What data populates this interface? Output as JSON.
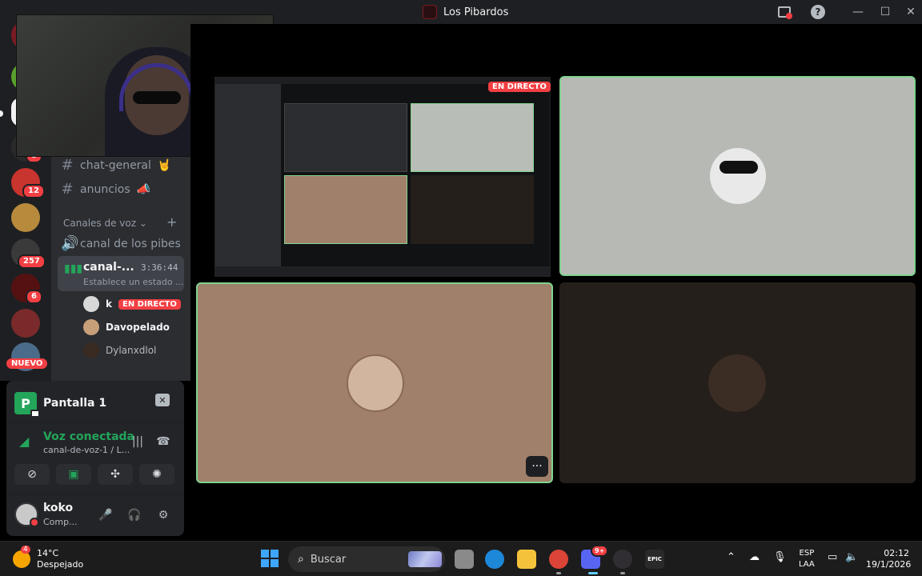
{
  "window": {
    "title": "Los Pibardos"
  },
  "servers": {
    "badges": [
      "8",
      "12",
      "257",
      "6"
    ],
    "new_label": "NUEVO"
  },
  "channels": {
    "text": [
      {
        "name": "chat-general",
        "emoji": "🤘"
      },
      {
        "name": "anuncios",
        "emoji": "📣"
      }
    ],
    "voice_category": "Canales de voz",
    "voice_channels": [
      {
        "name": "canal de los pibes"
      }
    ],
    "active_voice": {
      "name": "canal-...",
      "time": "3:36:44",
      "status": "Establece un estado ..."
    },
    "members": [
      {
        "name": "k",
        "badge": "EN DIRECTO"
      },
      {
        "name": "Davopelado"
      },
      {
        "name": "Dylanxdlol"
      }
    ]
  },
  "user_panel": {
    "screen_label": "Pantalla 1",
    "voice_title": "Voz conectada",
    "voice_sub": "canal-de-voz-1 / L...",
    "username": "koko",
    "user_status": "Comp..."
  },
  "stage": {
    "live_label": "EN DIRECTO",
    "nested_title": "Los Pibardos",
    "more": "···"
  },
  "taskbar": {
    "temp": "14°C",
    "weather": "Despejado",
    "weather_badge": "4",
    "search_placeholder": "Buscar",
    "discord_badge": "9+",
    "lang_top": "ESP",
    "lang_bottom": "LAA",
    "time": "02:12",
    "date": "19/1/2026"
  },
  "colors": {
    "accent_green": "#23a55a",
    "live_red": "#f23f43",
    "speaking_border": "#7fd38d"
  }
}
